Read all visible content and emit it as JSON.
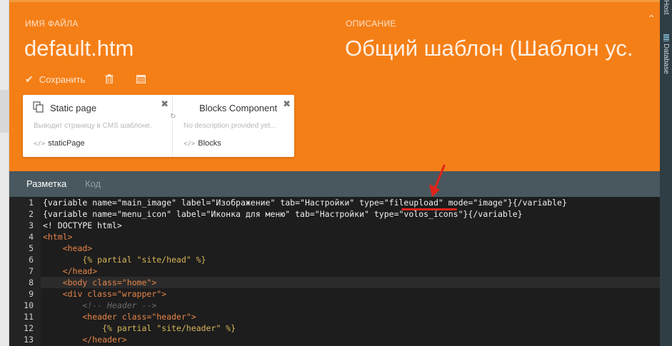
{
  "header": {
    "filename_label": "ИМЯ ФАЙЛА",
    "filename": "default.htm",
    "description_label": "ОПИСАНИЕ",
    "description": "Общий шаблон (Шаблон ус.",
    "save_label": "Сохранить",
    "collapse_glyph": "⌃"
  },
  "right_panel": {
    "tab_host": "Host",
    "tab_database": "Database"
  },
  "components": [
    {
      "title": "Static page",
      "description": "Выводит страницу в CMS шаблоне.",
      "code": "staticPage"
    },
    {
      "title": "Blocks Component",
      "description": "No description provided yet...",
      "code": "Blocks"
    }
  ],
  "tabs": {
    "markup": "Разметка",
    "code": "Код"
  },
  "editor": {
    "line_numbers": [
      "1",
      "2",
      "3",
      "4",
      "5",
      "6",
      "7",
      "8",
      "9",
      "10",
      "11",
      "12",
      "13"
    ],
    "lines": [
      "{variable name=\"main_image\" label=\"Изображение\" tab=\"Настройки\" type=\"fileupload\" mode=\"image\"}{/variable}",
      "{variable name=\"menu_icon\" label=\"Иконка для меню\" tab=\"Настройки\" type=\"volos_icons\"}{/variable}",
      "<! DOCTYPE html>",
      "<html>",
      "    <head>",
      "        {% partial \"site/head\" %}",
      "    </head>",
      "    <body class=\"home\">",
      "    <div class=\"wrapper\">",
      "        <!-- Header -->",
      "        <header class=\"header\">",
      "            {% partial \"site/header\" %}",
      "        </header>"
    ]
  },
  "colors": {
    "accent_orange": "#f57f17",
    "tab_bar": "#48585e",
    "editor_bg": "#1d1d1d",
    "annotation_red": "#e0241b"
  },
  "icons": [
    "check-icon",
    "trash-icon",
    "calendar-icon",
    "static-page-icon",
    "code-icon",
    "close-icon",
    "refresh-icon",
    "database-icon",
    "collapse-icon"
  ]
}
